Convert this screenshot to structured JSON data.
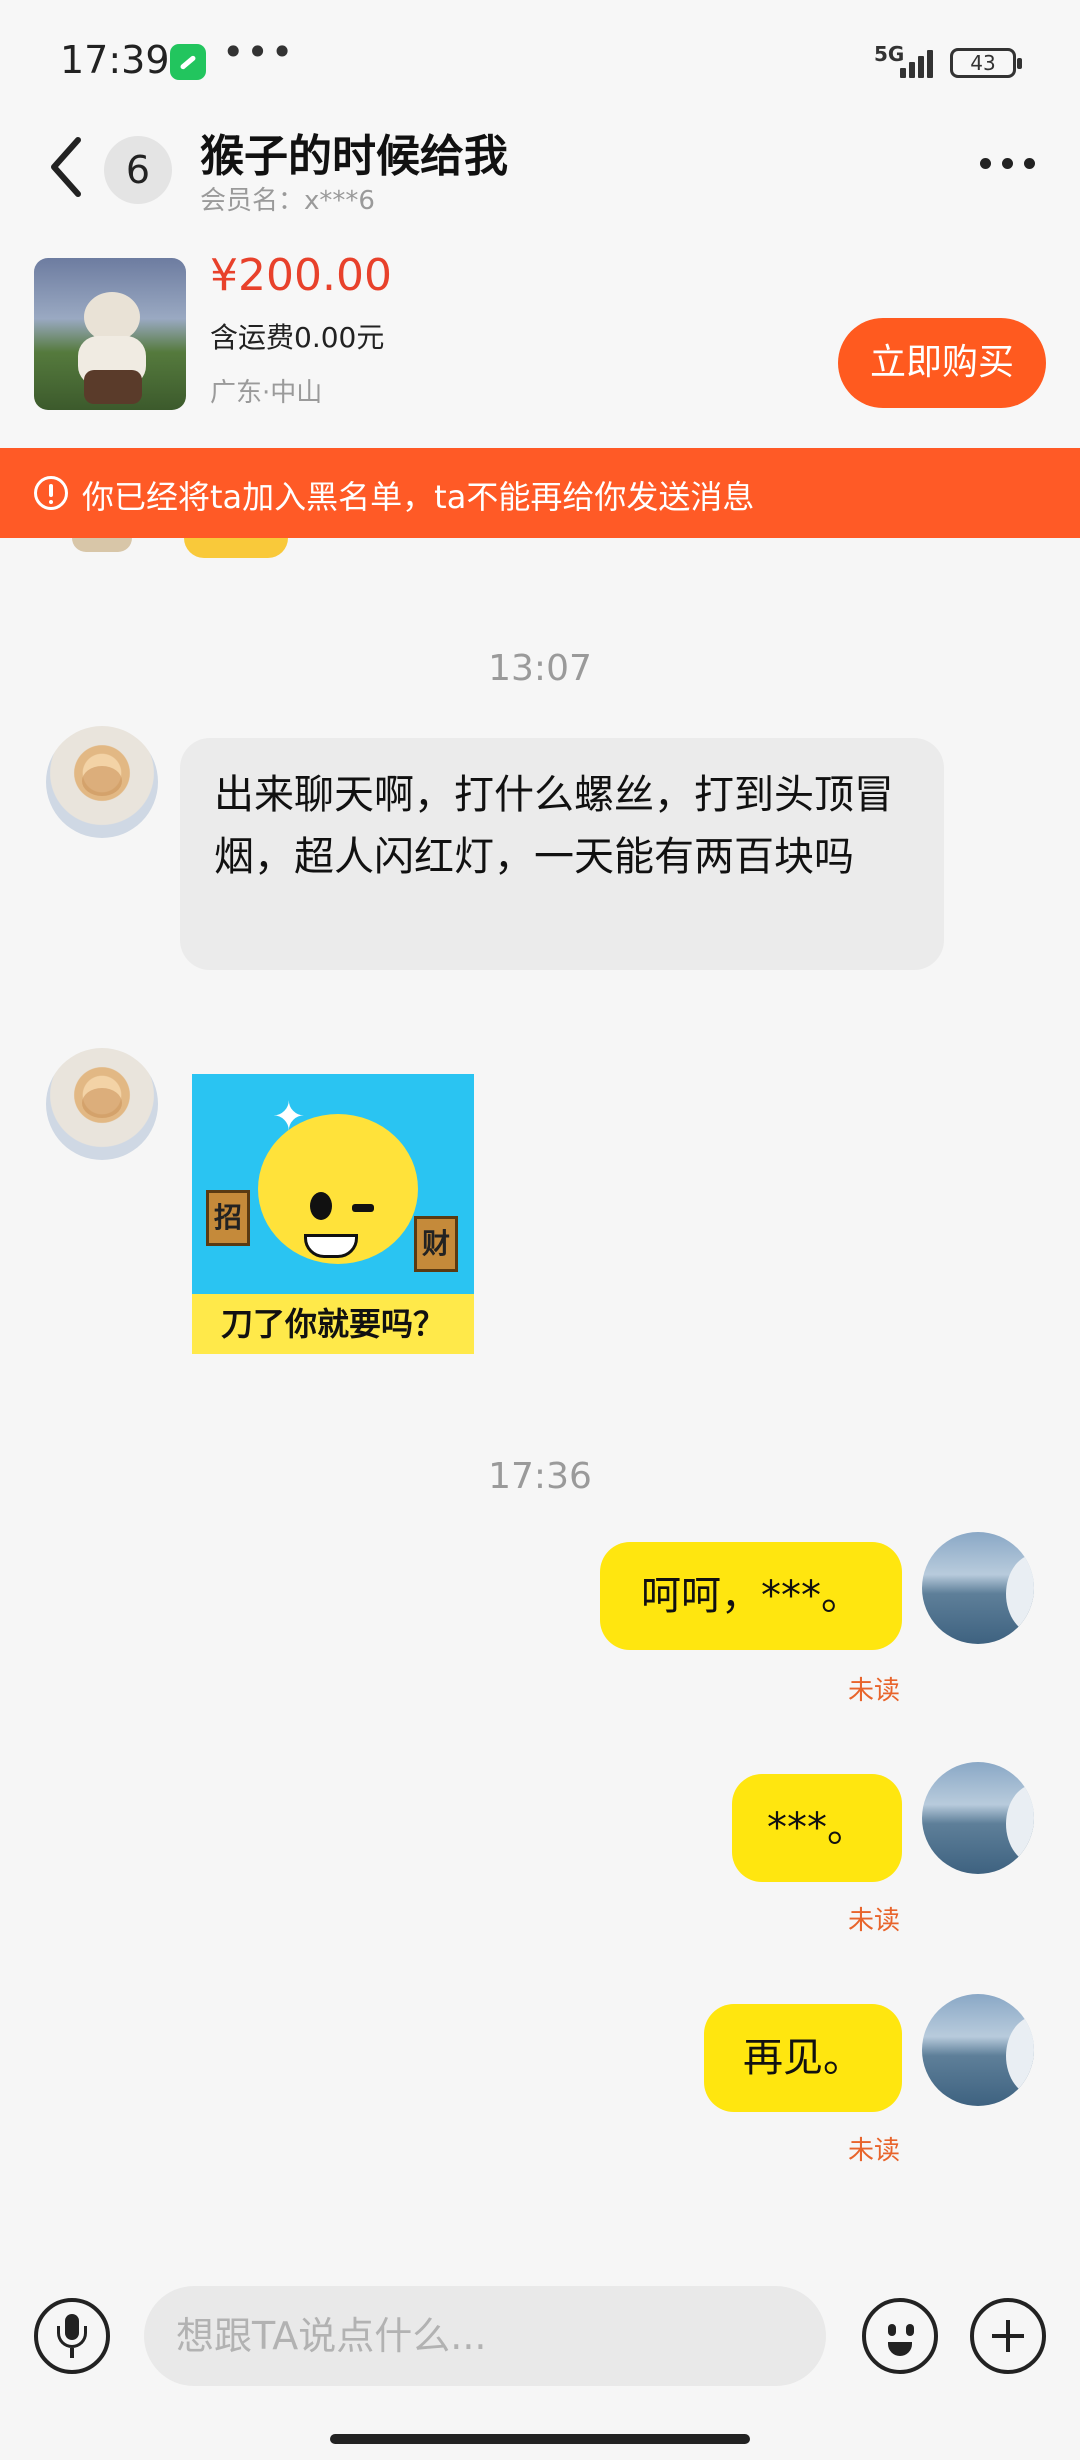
{
  "status_bar": {
    "time": "17:39",
    "network": "5G",
    "battery": "43"
  },
  "header": {
    "unread_count": "6",
    "title": "猴子的时候给我",
    "member": "会员名：x***6"
  },
  "product": {
    "price": "¥200.00",
    "shipping": "含运费0.00元",
    "location": "广东·中山",
    "buy_label": "立即购买"
  },
  "banner": {
    "text": "你已经将ta加入黑名单，ta不能再给你发送消息"
  },
  "chat": {
    "timestamp_1": "13:07",
    "received_text": "出来聊天啊，打什么螺丝，打到头顶冒烟，超人闪红灯，一天能有两百块吗",
    "sticker": {
      "caption": "刀了你就要吗？",
      "left_fist": "招",
      "right_fist": "财"
    },
    "timestamp_2": "17:36",
    "sent": [
      {
        "text": "呵呵，***。",
        "status": "未读"
      },
      {
        "text": "***。",
        "status": "未读"
      },
      {
        "text": "再见。",
        "status": "未读"
      }
    ]
  },
  "input": {
    "placeholder": "想跟TA说点什么..."
  },
  "colors": {
    "accent": "#ff5a1f",
    "price": "#e8412b",
    "sent_bubble": "#ffe60f",
    "received_bubble": "#ebebeb",
    "unread": "#e8642b"
  }
}
